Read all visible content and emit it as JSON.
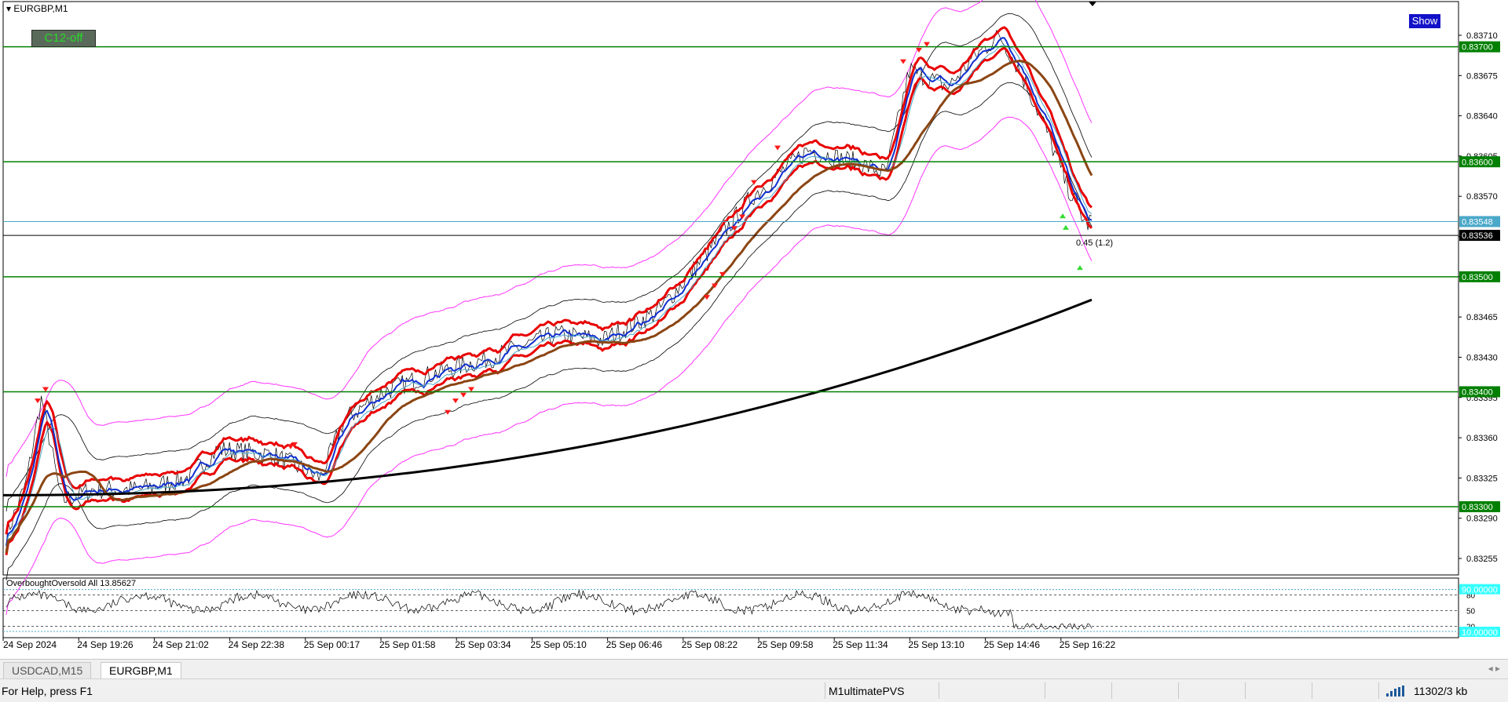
{
  "window": {
    "symbol_title": "EURGBP,M1",
    "c12_button": "C12-off",
    "show_button": "Show"
  },
  "chart": {
    "price_labels": [
      "0.83710",
      "0.83675",
      "0.83640",
      "0.83605",
      "0.83570",
      "0.83535",
      "0.83500",
      "0.83465",
      "0.83430",
      "0.83395",
      "0.83360",
      "0.83325",
      "0.83290",
      "0.83255"
    ],
    "level_lines": [
      {
        "price": "0.83700",
        "color": "#008000"
      },
      {
        "price": "0.83600",
        "color": "#008000"
      },
      {
        "price": "0.83500",
        "color": "#008000"
      },
      {
        "price": "0.83400",
        "color": "#008000"
      },
      {
        "price": "0.83300",
        "color": "#008000"
      }
    ],
    "bid_line": {
      "price": "0.83548",
      "color": "#4aa8c8"
    },
    "current_price": {
      "price": "0.83536",
      "color": "#000000"
    },
    "annotation": "0.45 (1.2)",
    "time_labels": [
      "24 Sep 2024",
      "24 Sep 19:26",
      "24 Sep 21:02",
      "24 Sep 22:38",
      "25 Sep 00:17",
      "25 Sep 01:58",
      "25 Sep 03:34",
      "25 Sep 05:10",
      "25 Sep 06:46",
      "25 Sep 08:22",
      "25 Sep 09:58",
      "25 Sep 11:34",
      "25 Sep 13:10",
      "25 Sep 14:46",
      "25 Sep 16:22"
    ]
  },
  "indicator": {
    "title": "OverboughtOversold All 13.85627",
    "levels": [
      "80",
      "50",
      "20"
    ],
    "upper_label": "90.00000",
    "lower_label": "10.00000"
  },
  "tabs": [
    {
      "label": "USDCAD,M15",
      "active": false
    },
    {
      "label": "EURGBP,M1",
      "active": true
    }
  ],
  "status": {
    "help": "For Help, press F1",
    "profile": "M1ultimatePVS",
    "traffic": "11302/3 kb"
  }
}
